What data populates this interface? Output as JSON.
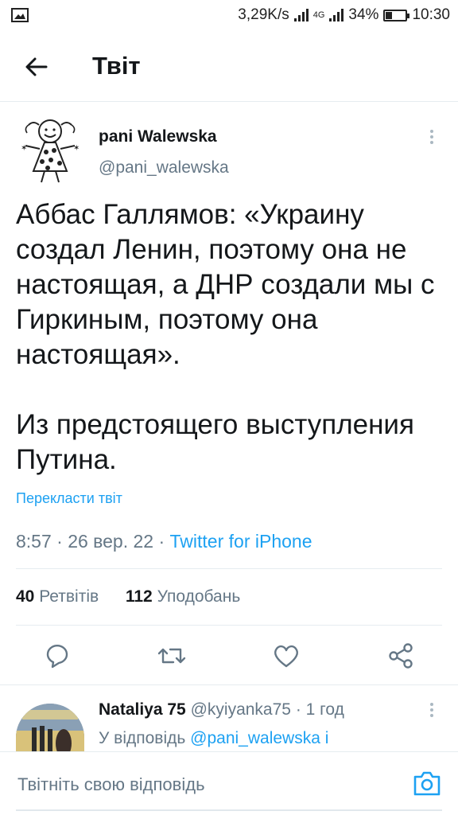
{
  "status_bar": {
    "network_speed": "3,29K/s",
    "network_type": "4G",
    "battery_percent_label": "34%",
    "battery_level": 0.34,
    "time": "10:30"
  },
  "header": {
    "title": "Твіт"
  },
  "tweet": {
    "author_name": "pani Walewska",
    "author_handle": "@pani_walewska",
    "paragraphs": [
      "Аббас Галлямов: «Украину создал Ленин, поэтому она не настоящая, а ДНР создали мы с Гиркиным, поэтому она настоящая».",
      "Из предстоящего выступления Путина."
    ],
    "translate_label": "Перекласти твіт",
    "timestamp": "8:57 · 26 вер. 22 · ",
    "source": "Twitter for iPhone",
    "retweets_count": "40",
    "retweets_label": "Ретвітів",
    "likes_count": "112",
    "likes_label": "Уподобань"
  },
  "reply": {
    "author_name": "Nataliya 75",
    "author_handle": "@kyiyanka75",
    "time_ago": "· 1 год",
    "reply_prefix": "У відповідь ",
    "reply_target": "@pani_walewska і"
  },
  "composer": {
    "placeholder": "Твітніть свою відповідь"
  },
  "icons": {
    "back": "arrow-left-icon",
    "more": "more-vertical-icon",
    "reply": "comment-icon",
    "retweet": "retweet-icon",
    "like": "heart-icon",
    "share": "share-icon",
    "camera": "camera-icon"
  },
  "colors": {
    "accent": "#1da1f2",
    "muted": "#657786",
    "text": "#14171a"
  }
}
